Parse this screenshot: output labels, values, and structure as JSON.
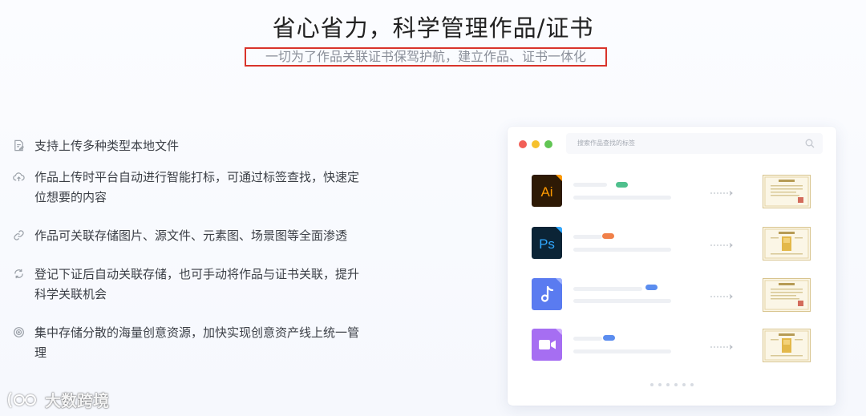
{
  "header": {
    "title": "省心省力，科学管理作品/证书",
    "subtitle": "一切为了作品关联证书保驾护航，建立作品、证书一体化"
  },
  "features": [
    {
      "icon": "file-edit-icon",
      "text": "支持上传多种类型本地文件"
    },
    {
      "icon": "cloud-upload-icon",
      "text": "作品上传时平台自动进行智能打标，可通过标签查找，快速定位想要的内容"
    },
    {
      "icon": "link-icon",
      "text": "作品可关联存储图片、源文件、元素图、场景图等全面渗透"
    },
    {
      "icon": "sync-icon",
      "text": "登记下证后自动关联存储，也可手动将作品与证书关联，提升科学关联机会"
    },
    {
      "icon": "storage-icon",
      "text": "集中存储分散的海量创意资源，加快实现创意资产线上统一管理"
    }
  ],
  "mock_window": {
    "search_placeholder": "搜索作品查找的标签",
    "rows": [
      {
        "file_type": "Ai",
        "file_icon": "illustrator-file-icon",
        "tag_color": "#4fc08d",
        "icon_bg": "#2e1a05",
        "icon_fg": "#ff9a00"
      },
      {
        "file_type": "Ps",
        "file_icon": "photoshop-file-icon",
        "tag_color": "#f08049",
        "icon_bg": "#0b2436",
        "icon_fg": "#31a8ff"
      },
      {
        "file_type": "",
        "file_icon": "audio-file-icon",
        "tag_color": "#5b8def",
        "icon_bg": "#5a7bf0",
        "icon_fg": "#ffffff"
      },
      {
        "file_type": "",
        "file_icon": "video-file-icon",
        "tag_color": "#5b8def",
        "icon_bg": "#a66ef2",
        "icon_fg": "#ffffff"
      }
    ],
    "page_dots": 6
  },
  "watermark": {
    "text": "大数跨境"
  }
}
